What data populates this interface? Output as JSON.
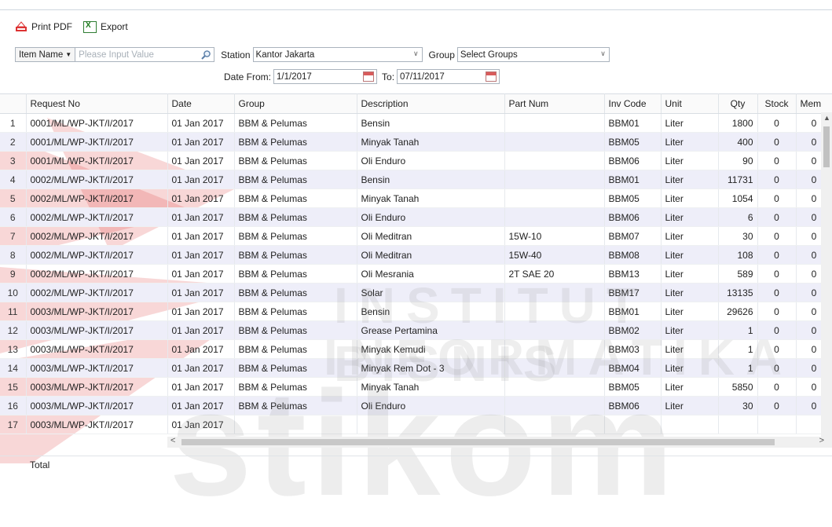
{
  "toolbar": {
    "print_pdf": "Print PDF",
    "export": "Export"
  },
  "filters": {
    "item_field": "Item Name",
    "search_placeholder": "Please Input Value",
    "station_label": "Station",
    "station_value": "Kantor Jakarta",
    "group_label": "Group",
    "group_value": "Select Groups",
    "date_from_label": "Date From:",
    "date_from_value": "1/1/2017",
    "date_to_label": "To:",
    "date_to_value": "07/11/2017"
  },
  "table": {
    "columns": [
      "Request No",
      "Date",
      "Group",
      "Description",
      "Part Num",
      "Inv Code",
      "Unit",
      "Qty",
      "Stock",
      "Mem"
    ],
    "rows": [
      [
        "1",
        "0001/ML/WP-JKT/I/2017",
        "01 Jan 2017",
        "BBM & Pelumas",
        "Bensin",
        "",
        "BBM01",
        "Liter",
        "1800",
        "0",
        "0"
      ],
      [
        "2",
        "0001/ML/WP-JKT/I/2017",
        "01 Jan 2017",
        "BBM & Pelumas",
        "Minyak Tanah",
        "",
        "BBM05",
        "Liter",
        "400",
        "0",
        "0"
      ],
      [
        "3",
        "0001/ML/WP-JKT/I/2017",
        "01 Jan 2017",
        "BBM & Pelumas",
        "Oli Enduro",
        "",
        "BBM06",
        "Liter",
        "90",
        "0",
        "0"
      ],
      [
        "4",
        "0002/ML/WP-JKT/I/2017",
        "01 Jan 2017",
        "BBM & Pelumas",
        "Bensin",
        "",
        "BBM01",
        "Liter",
        "11731",
        "0",
        "0"
      ],
      [
        "5",
        "0002/ML/WP-JKT/I/2017",
        "01 Jan 2017",
        "BBM & Pelumas",
        "Minyak Tanah",
        "",
        "BBM05",
        "Liter",
        "1054",
        "0",
        "0"
      ],
      [
        "6",
        "0002/ML/WP-JKT/I/2017",
        "01 Jan 2017",
        "BBM & Pelumas",
        "Oli Enduro",
        "",
        "BBM06",
        "Liter",
        "6",
        "0",
        "0"
      ],
      [
        "7",
        "0002/ML/WP-JKT/I/2017",
        "01 Jan 2017",
        "BBM & Pelumas",
        "Oli Meditran",
        "15W-10",
        "BBM07",
        "Liter",
        "30",
        "0",
        "0"
      ],
      [
        "8",
        "0002/ML/WP-JKT/I/2017",
        "01 Jan 2017",
        "BBM & Pelumas",
        "Oli Meditran",
        "15W-40",
        "BBM08",
        "Liter",
        "108",
        "0",
        "0"
      ],
      [
        "9",
        "0002/ML/WP-JKT/I/2017",
        "01 Jan 2017",
        "BBM & Pelumas",
        "Oli Mesrania",
        "2T SAE 20",
        "BBM13",
        "Liter",
        "589",
        "0",
        "0"
      ],
      [
        "10",
        "0002/ML/WP-JKT/I/2017",
        "01 Jan 2017",
        "BBM & Pelumas",
        "Solar",
        "",
        "BBM17",
        "Liter",
        "13135",
        "0",
        "0"
      ],
      [
        "11",
        "0003/ML/WP-JKT/I/2017",
        "01 Jan 2017",
        "BBM & Pelumas",
        "Bensin",
        "",
        "BBM01",
        "Liter",
        "29626",
        "0",
        "0"
      ],
      [
        "12",
        "0003/ML/WP-JKT/I/2017",
        "01 Jan 2017",
        "BBM & Pelumas",
        "Grease Pertamina",
        "",
        "BBM02",
        "Liter",
        "1",
        "0",
        "0"
      ],
      [
        "13",
        "0003/ML/WP-JKT/I/2017",
        "01 Jan 2017",
        "BBM & Pelumas",
        "Minyak Kemudi",
        "",
        "BBM03",
        "Liter",
        "1",
        "0",
        "0"
      ],
      [
        "14",
        "0003/ML/WP-JKT/I/2017",
        "01 Jan 2017",
        "BBM & Pelumas",
        "Minyak Rem Dot - 3",
        "",
        "BBM04",
        "Liter",
        "1",
        "0",
        "0"
      ],
      [
        "15",
        "0003/ML/WP-JKT/I/2017",
        "01 Jan 2017",
        "BBM & Pelumas",
        "Minyak Tanah",
        "",
        "BBM05",
        "Liter",
        "5850",
        "0",
        "0"
      ],
      [
        "16",
        "0003/ML/WP-JKT/I/2017",
        "01 Jan 2017",
        "BBM & Pelumas",
        "Oli Enduro",
        "",
        "BBM06",
        "Liter",
        "30",
        "0",
        "0"
      ],
      [
        "17",
        "0003/ML/WP-JKT/I/2017",
        "01 Jan 2017",
        "",
        "",
        "",
        "",
        "",
        "",
        "",
        ""
      ]
    ],
    "total_label": "Total"
  },
  "watermark": {
    "line1": "INSTITUT BISNIS",
    "line2": "INFORMATIKA",
    "brand": "stikom"
  },
  "colors": {
    "alt_row": "#eeeef9",
    "logo_red": "#e04848"
  }
}
